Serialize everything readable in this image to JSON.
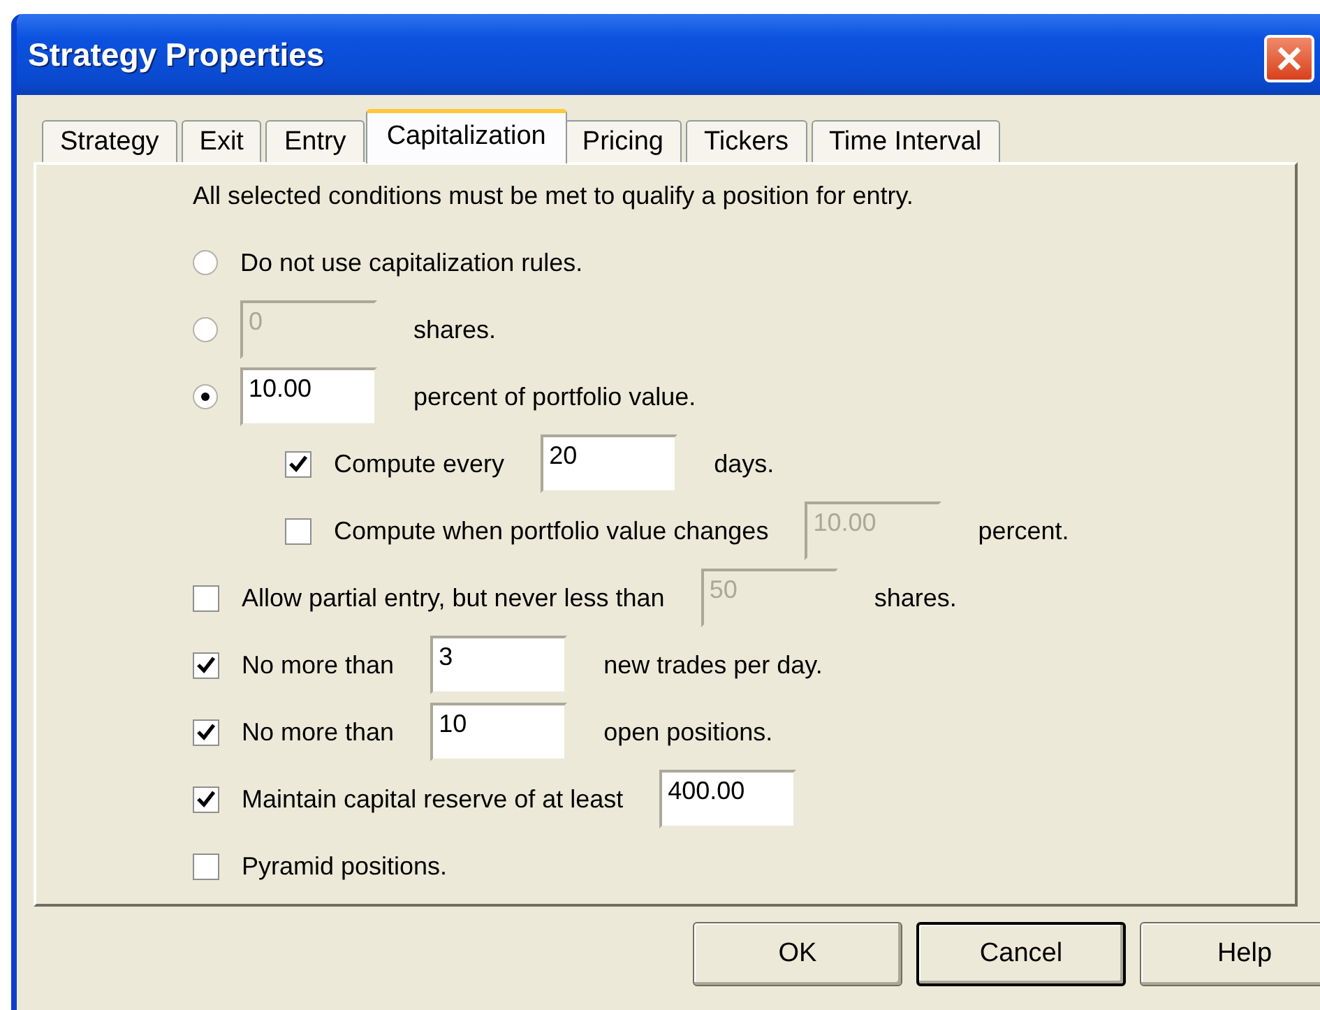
{
  "window": {
    "title": "Strategy Properties"
  },
  "tabs": [
    {
      "label": "Strategy",
      "selected": false
    },
    {
      "label": "Exit",
      "selected": false
    },
    {
      "label": "Entry",
      "selected": false
    },
    {
      "label": "Capitalization",
      "selected": true
    },
    {
      "label": "Pricing",
      "selected": false
    },
    {
      "label": "Tickers",
      "selected": false
    },
    {
      "label": "Time Interval",
      "selected": false
    }
  ],
  "intro": "All selected conditions must be met to qualify a position for entry.",
  "rows": [
    {
      "kind": "radio",
      "selected": false,
      "label": "Do not use capitalization rules."
    },
    {
      "kind": "radio",
      "selected": false,
      "field": {
        "value": "0",
        "disabled": true
      },
      "suffix": "shares."
    },
    {
      "kind": "radio",
      "selected": true,
      "field": {
        "value": "10.00",
        "disabled": false
      },
      "suffix": "percent of portfolio value.",
      "children": [
        {
          "kind": "checkbox",
          "checked": true,
          "label": "Compute every",
          "field": {
            "value": "20",
            "disabled": false
          },
          "suffix": "days."
        },
        {
          "kind": "checkbox",
          "checked": false,
          "label": "Compute when portfolio value changes",
          "field": {
            "value": "10.00",
            "disabled": true
          },
          "suffix": "percent."
        }
      ]
    },
    {
      "kind": "checkbox",
      "checked": false,
      "label": "Allow partial entry, but never less than",
      "field": {
        "value": "50",
        "disabled": true
      },
      "suffix": "shares."
    },
    {
      "kind": "checkbox",
      "checked": true,
      "label": "No more than",
      "field": {
        "value": "3",
        "disabled": false
      },
      "suffix": "new trades per day."
    },
    {
      "kind": "checkbox",
      "checked": true,
      "label": "No more than",
      "field": {
        "value": "10",
        "disabled": false
      },
      "suffix": "open positions."
    },
    {
      "kind": "checkbox",
      "checked": true,
      "label": "Maintain capital reserve of at least",
      "field": {
        "value": "400.00",
        "disabled": false
      }
    },
    {
      "kind": "checkbox",
      "checked": false,
      "label": "Pyramid positions."
    }
  ],
  "buttons": [
    {
      "label": "OK",
      "selected": false
    },
    {
      "label": "Cancel",
      "selected": true
    },
    {
      "label": "Help",
      "selected": false
    }
  ]
}
